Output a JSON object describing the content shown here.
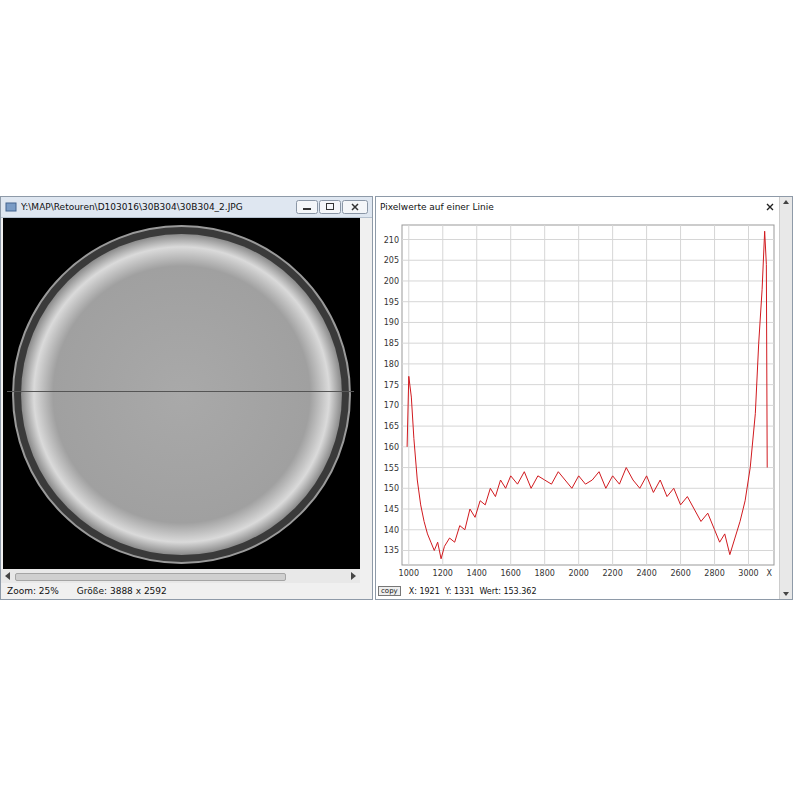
{
  "left_window": {
    "title": "Y:\\MAP\\Retouren\\D103016\\30B304\\30B304_2.JPG",
    "status": {
      "zoom": "Zoom: 25%",
      "size": "Größe: 3888 x 2592"
    },
    "scrollbar": {
      "level": 0.82
    }
  },
  "right_window": {
    "title": "Pixelwerte auf einer Linie",
    "chart": {
      "y_ticks": [
        "135",
        "140",
        "145",
        "150",
        "155",
        "160",
        "165",
        "170",
        "175",
        "180",
        "185",
        "190",
        "195",
        "200",
        "205",
        "210"
      ],
      "x_ticks": [
        "1000",
        "1200",
        "1400",
        "1600",
        "1800",
        "2000",
        "2200",
        "2400",
        "2600",
        "2800",
        "3000"
      ],
      "x_axis_label": "X",
      "series": [
        {
          "name": "Pixelwerte",
          "x": [
            990,
            1000,
            1015,
            1030,
            1050,
            1070,
            1090,
            1110,
            1130,
            1150,
            1170,
            1190,
            1210,
            1240,
            1270,
            1300,
            1330,
            1360,
            1390,
            1420,
            1450,
            1480,
            1510,
            1540,
            1570,
            1600,
            1640,
            1680,
            1720,
            1760,
            1800,
            1840,
            1880,
            1920,
            1960,
            2000,
            2040,
            2080,
            2120,
            2160,
            2200,
            2240,
            2280,
            2320,
            2360,
            2400,
            2440,
            2480,
            2520,
            2560,
            2600,
            2640,
            2680,
            2720,
            2760,
            2800,
            2830,
            2860,
            2890,
            2920,
            2950,
            2980,
            3010,
            3040,
            3060,
            3080,
            3095,
            3105,
            3110
          ],
          "values": [
            160,
            177,
            172,
            162,
            152,
            146,
            142,
            139,
            137,
            135,
            137,
            133,
            136,
            138,
            137,
            141,
            140,
            145,
            143,
            147,
            146,
            150,
            148,
            152,
            150,
            153,
            151,
            154,
            150,
            153,
            152,
            151,
            154,
            152,
            150,
            153,
            151,
            152,
            154,
            150,
            153,
            151,
            155,
            152,
            150,
            153,
            149,
            152,
            148,
            150,
            146,
            148,
            145,
            142,
            144,
            140,
            137,
            139,
            134,
            138,
            142,
            147,
            155,
            168,
            185,
            198,
            212,
            204,
            155
          ]
        }
      ]
    },
    "copy_button": "copy",
    "readout": "X: 1921  Y: 1331  Wert: 153.362"
  }
}
